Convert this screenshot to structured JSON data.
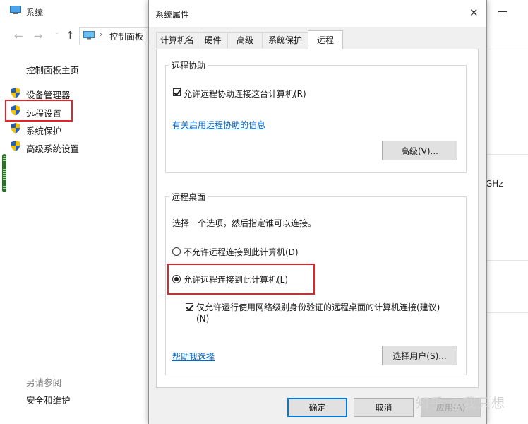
{
  "background_window": {
    "title": "系统",
    "address_text": "控制面板",
    "address_separator": "›",
    "nav": {
      "back_icon": "arrow-left-icon",
      "forward_icon": "arrow-right-icon",
      "up_icon": "arrow-up-icon"
    },
    "sidebar": {
      "home_link": "控制面板主页",
      "items": [
        {
          "label": "设备管理器",
          "icon": "shield-icon"
        },
        {
          "label": "远程设置",
          "icon": "shield-icon",
          "highlighted": true
        },
        {
          "label": "系统保护",
          "icon": "shield-icon"
        },
        {
          "label": "高级系统设置",
          "icon": "shield-icon"
        }
      ],
      "see_also_title": "另请参阅",
      "see_also_items": [
        "安全和维护"
      ]
    },
    "right_fragment_text": "GHz"
  },
  "dialog": {
    "title": "系统属性",
    "tabs": [
      {
        "label": "计算机名",
        "active": false
      },
      {
        "label": "硬件",
        "active": false
      },
      {
        "label": "高级",
        "active": false
      },
      {
        "label": "系统保护",
        "active": false
      },
      {
        "label": "远程",
        "active": true
      }
    ],
    "remote_assistance": {
      "legend": "远程协助",
      "allow_checkbox": {
        "label": "允许远程协助连接这台计算机(R)",
        "checked": true
      },
      "info_link": "有关启用远程协助的信息",
      "advanced_button": "高级(V)..."
    },
    "remote_desktop": {
      "legend": "远程桌面",
      "instruction": "选择一个选项，然后指定谁可以连接。",
      "option_disallow": {
        "label": "不允许远程连接到此计算机(D)",
        "selected": false
      },
      "option_allow": {
        "label": "允许远程连接到此计算机(L)",
        "selected": true
      },
      "nla_checkbox": {
        "label_line1": "仅允许运行使用网络级别身份验证的远程桌面的计算机连接(建议)",
        "label_line2": "(N)",
        "checked": true
      },
      "help_link": "帮助我选择",
      "select_users_button": "选择用户(S)..."
    },
    "buttons": {
      "ok": "确定",
      "cancel": "取消",
      "apply": "应用(A)"
    }
  },
  "watermark": "知乎 @我只想",
  "colors": {
    "highlight_red": "#e2242b",
    "link_blue": "#0066cc",
    "focus_blue": "#0078d7",
    "dialog_bg": "#f0f0f0"
  }
}
